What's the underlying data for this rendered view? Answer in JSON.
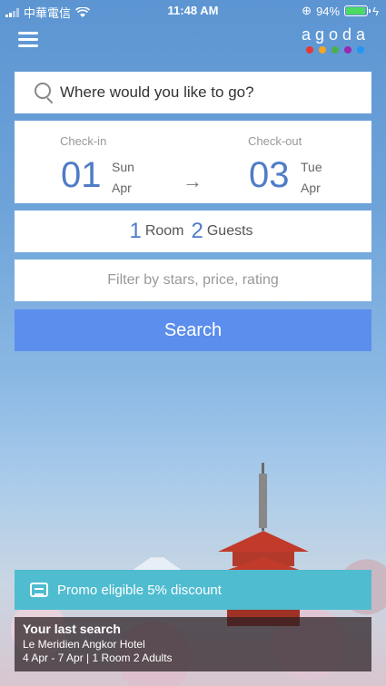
{
  "status_bar": {
    "carrier": "中華電信",
    "time": "11:48 AM",
    "battery": "94%"
  },
  "header": {
    "logo": "agoda",
    "logo_dot_colors": [
      "#e53935",
      "#f5a623",
      "#4caf50",
      "#9c27b0",
      "#2196f3"
    ]
  },
  "search": {
    "placeholder": "Where would you like to go?"
  },
  "dates": {
    "checkin": {
      "label": "Check-in",
      "day": "01",
      "weekday": "Sun",
      "month": "Apr"
    },
    "checkout": {
      "label": "Check-out",
      "day": "03",
      "weekday": "Tue",
      "month": "Apr"
    },
    "arrow": "→"
  },
  "occupancy": {
    "rooms": "1",
    "rooms_label": "Room",
    "guests": "2",
    "guests_label": "Guests"
  },
  "filter": {
    "label": "Filter by stars, price, rating"
  },
  "search_button": {
    "label": "Search"
  },
  "promo": {
    "text": "Promo eligible 5% discount"
  },
  "last_search": {
    "title": "Your last search",
    "hotel": "Le Meridien Angkor Hotel",
    "details": "4 Apr - 7 Apr | 1 Room 2 Adults"
  },
  "colors": {
    "accent": "#4f7cc7",
    "button": "#5b8eed",
    "promo": "#4fbcd0"
  }
}
